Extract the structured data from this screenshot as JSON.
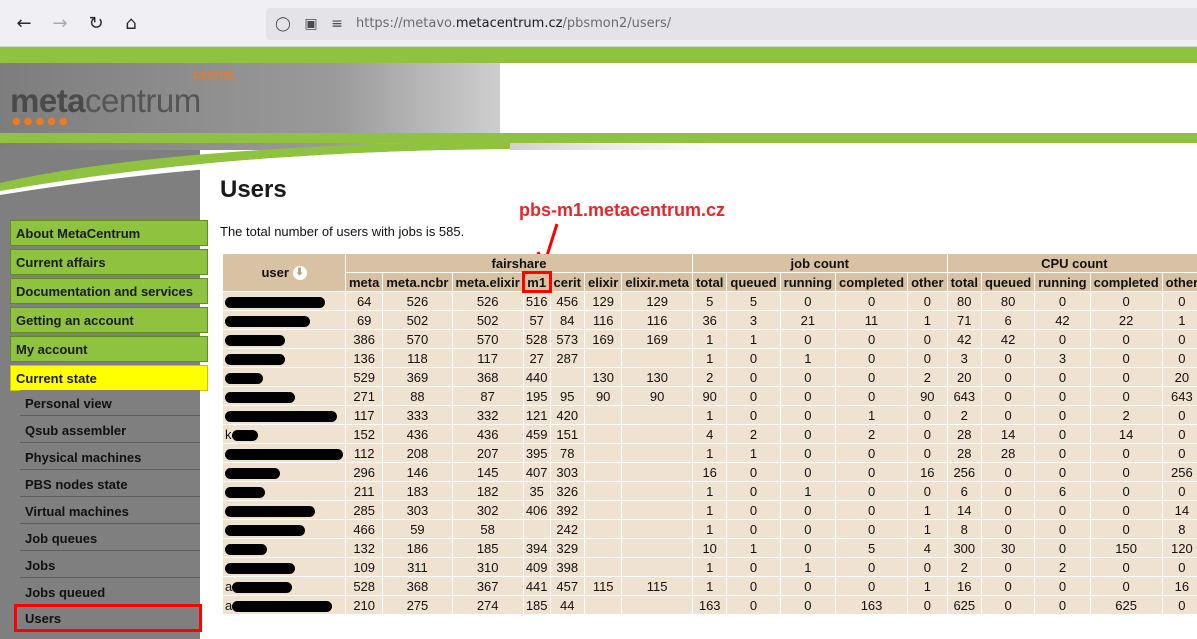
{
  "browser": {
    "url_prefix": "https://metavo.",
    "url_domain": "metacentrum.cz",
    "url_path": "/pbsmon2/users/"
  },
  "header": {
    "logo_meta": "meta",
    "logo_centrum": "centrum",
    "cesnet": "cesnet"
  },
  "sidebar": {
    "menu": [
      {
        "label": "About MetaCentrum",
        "active": false
      },
      {
        "label": "Current affairs",
        "active": false
      },
      {
        "label": "Documentation and services",
        "active": false
      },
      {
        "label": "Getting an account",
        "active": false
      },
      {
        "label": "My account",
        "active": false
      },
      {
        "label": "Current state",
        "active": true
      }
    ],
    "submenu": [
      {
        "label": "Personal view"
      },
      {
        "label": "Qsub assembler"
      },
      {
        "label": "Physical machines"
      },
      {
        "label": "PBS nodes state"
      },
      {
        "label": "Virtual machines"
      },
      {
        "label": "Job queues"
      },
      {
        "label": "Jobs"
      },
      {
        "label": "Jobs queued"
      },
      {
        "label": "Users",
        "highlight": true
      }
    ]
  },
  "main": {
    "title": "Users",
    "summary": "The total number of users with jobs is 585.",
    "annotation": "pbs-m1.metacentrum.cz"
  },
  "table": {
    "user_header": "user",
    "groups": [
      {
        "label": "fairshare",
        "span": 7
      },
      {
        "label": "job count",
        "span": 5
      },
      {
        "label": "CPU count",
        "span": 5
      }
    ],
    "columns": [
      "meta",
      "meta.ncbr",
      "meta.elixir",
      "m1",
      "cerit",
      "elixir",
      "elixir.meta",
      "total",
      "queued",
      "running",
      "completed",
      "other",
      "total",
      "queued",
      "running",
      "completed",
      "other"
    ],
    "rows": [
      {
        "user_w": 100,
        "prefix": "",
        "cells": [
          "64",
          "526",
          "526",
          "516",
          "456",
          "129",
          "129",
          "5",
          "5",
          "0",
          "0",
          "0",
          "80",
          "80",
          "0",
          "0",
          "0"
        ]
      },
      {
        "user_w": 85,
        "prefix": "",
        "cells": [
          "69",
          "502",
          "502",
          "57",
          "84",
          "116",
          "116",
          "36",
          "3",
          "21",
          "11",
          "1",
          "71",
          "6",
          "42",
          "22",
          "1"
        ]
      },
      {
        "user_w": 60,
        "prefix": "",
        "cells": [
          "386",
          "570",
          "570",
          "528",
          "573",
          "169",
          "169",
          "1",
          "1",
          "0",
          "0",
          "0",
          "42",
          "42",
          "0",
          "0",
          "0"
        ]
      },
      {
        "user_w": 60,
        "prefix": "",
        "cells": [
          "136",
          "118",
          "117",
          "27",
          "287",
          "",
          "",
          "1",
          "0",
          "1",
          "0",
          "0",
          "3",
          "0",
          "3",
          "0",
          "0"
        ]
      },
      {
        "user_w": 38,
        "prefix": "",
        "cells": [
          "529",
          "369",
          "368",
          "440",
          "",
          "130",
          "130",
          "2",
          "0",
          "0",
          "0",
          "2",
          "20",
          "0",
          "0",
          "0",
          "20"
        ]
      },
      {
        "user_w": 70,
        "prefix": "",
        "cells": [
          "271",
          "88",
          "87",
          "195",
          "95",
          "90",
          "90",
          "90",
          "0",
          "0",
          "0",
          "90",
          "643",
          "0",
          "0",
          "0",
          "643"
        ]
      },
      {
        "user_w": 112,
        "prefix": "",
        "cells": [
          "117",
          "333",
          "332",
          "121",
          "420",
          "",
          "",
          "1",
          "0",
          "0",
          "1",
          "0",
          "2",
          "0",
          "0",
          "2",
          "0"
        ]
      },
      {
        "user_w": 26,
        "prefix": "k",
        "cells": [
          "152",
          "436",
          "436",
          "459",
          "151",
          "",
          "",
          "4",
          "2",
          "0",
          "2",
          "0",
          "28",
          "14",
          "0",
          "14",
          "0"
        ]
      },
      {
        "user_w": 118,
        "prefix": "",
        "cells": [
          "112",
          "208",
          "207",
          "395",
          "78",
          "",
          "",
          "1",
          "1",
          "0",
          "0",
          "0",
          "28",
          "28",
          "0",
          "0",
          "0"
        ]
      },
      {
        "user_w": 55,
        "prefix": "",
        "cells": [
          "296",
          "146",
          "145",
          "407",
          "303",
          "",
          "",
          "16",
          "0",
          "0",
          "0",
          "16",
          "256",
          "0",
          "0",
          "0",
          "256"
        ]
      },
      {
        "user_w": 40,
        "prefix": "",
        "cells": [
          "211",
          "183",
          "182",
          "35",
          "326",
          "",
          "",
          "1",
          "0",
          "1",
          "0",
          "0",
          "6",
          "0",
          "6",
          "0",
          "0"
        ]
      },
      {
        "user_w": 90,
        "prefix": "",
        "cells": [
          "285",
          "303",
          "302",
          "406",
          "392",
          "",
          "",
          "1",
          "0",
          "0",
          "0",
          "1",
          "14",
          "0",
          "0",
          "0",
          "14"
        ]
      },
      {
        "user_w": 80,
        "prefix": "",
        "cells": [
          "466",
          "59",
          "58",
          "",
          "242",
          "",
          "",
          "1",
          "0",
          "0",
          "0",
          "1",
          "8",
          "0",
          "0",
          "0",
          "8"
        ]
      },
      {
        "user_w": 42,
        "prefix": "",
        "cells": [
          "132",
          "186",
          "185",
          "394",
          "329",
          "",
          "",
          "10",
          "1",
          "0",
          "5",
          "4",
          "300",
          "30",
          "0",
          "150",
          "120"
        ]
      },
      {
        "user_w": 70,
        "prefix": "",
        "cells": [
          "109",
          "311",
          "310",
          "409",
          "398",
          "",
          "",
          "1",
          "0",
          "1",
          "0",
          "0",
          "2",
          "0",
          "2",
          "0",
          "0"
        ]
      },
      {
        "user_w": 60,
        "prefix": "a",
        "cells": [
          "528",
          "368",
          "367",
          "441",
          "457",
          "115",
          "115",
          "1",
          "0",
          "0",
          "0",
          "1",
          "16",
          "0",
          "0",
          "0",
          "16"
        ]
      },
      {
        "user_w": 100,
        "prefix": "a",
        "cells": [
          "210",
          "275",
          "274",
          "185",
          "44",
          "",
          "",
          "163",
          "0",
          "0",
          "163",
          "0",
          "625",
          "0",
          "0",
          "625",
          "0"
        ]
      }
    ]
  },
  "colors": {
    "green": "#8fc23f",
    "yellow_active": "#ffff00",
    "table_header": "#d9c2a3",
    "table_cell": "#f0e2d0",
    "annotation_red": "#e8262a"
  }
}
